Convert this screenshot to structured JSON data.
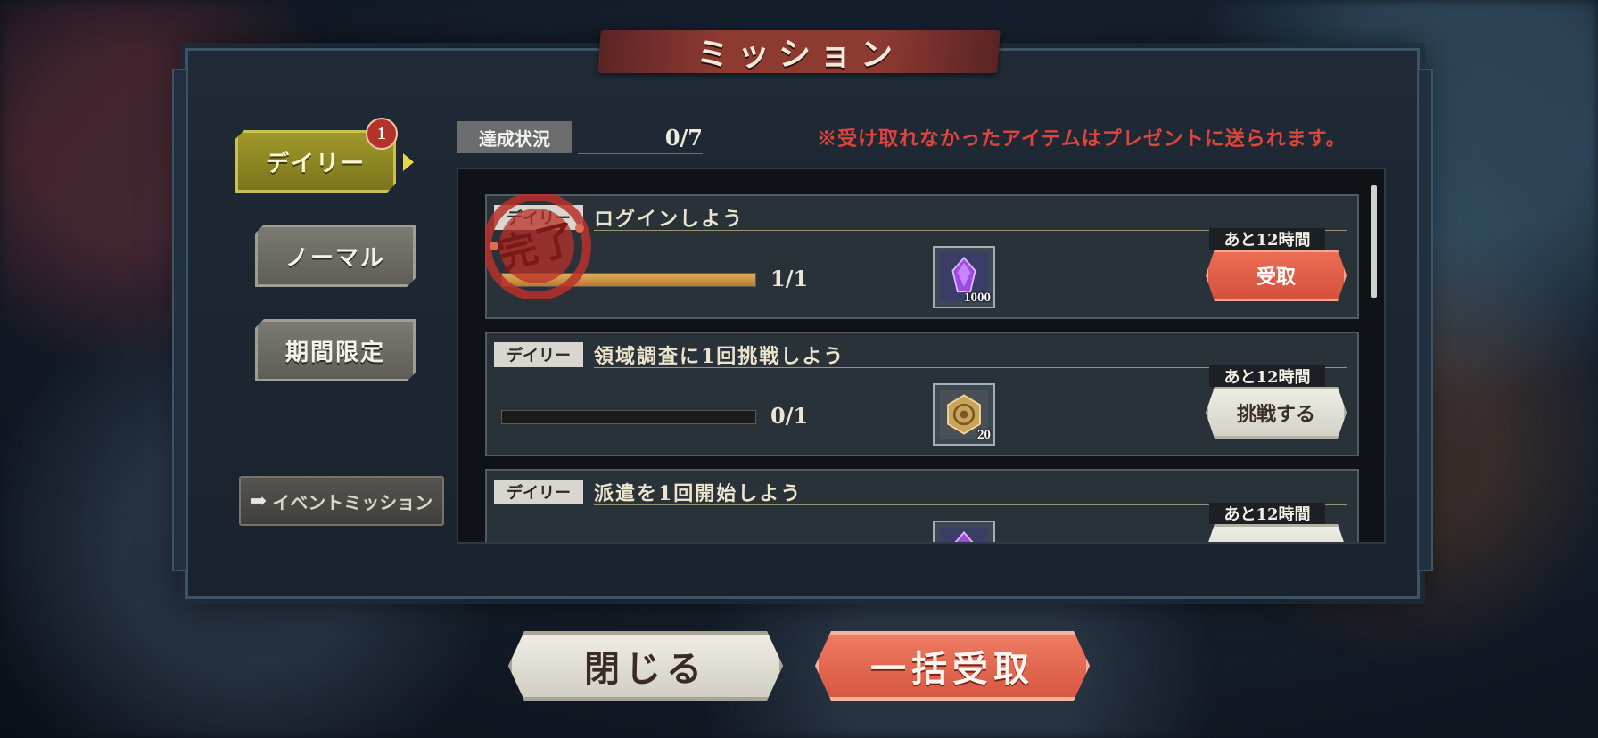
{
  "window": {
    "title": "ミッション"
  },
  "tabs": [
    {
      "label": "デイリー",
      "selected": true,
      "badge": "1"
    },
    {
      "label": "ノーマル",
      "selected": false
    },
    {
      "label": "期間限定",
      "selected": false
    }
  ],
  "event_button": {
    "label": "イベントミッション",
    "icon": "arrow-right-icon"
  },
  "status": {
    "label": "達成状況",
    "value": "0/7"
  },
  "notice": "※受け取れなかったアイテムはプレゼントに送られます。",
  "missions": [
    {
      "tag": "デイリー",
      "title": "ログインしよう",
      "progress": "1/1",
      "progress_fraction": 1.0,
      "reward_icon": "purple-crystal-icon",
      "reward_qty": "1000",
      "time_left": "あと12時間",
      "button": "受取",
      "button_style": "red",
      "completed_stamp": "完了"
    },
    {
      "tag": "デイリー",
      "title": "領域調査に1回挑戦しよう",
      "progress": "0/1",
      "progress_fraction": 0.0,
      "reward_icon": "gold-coin-icon",
      "reward_qty": "20",
      "time_left": "あと12時間",
      "button": "挑戦する",
      "button_style": "cream"
    },
    {
      "tag": "デイリー",
      "title": "派遣を1回開始しよう",
      "reward_icon": "purple-crystal-icon",
      "time_left": "あと12時間"
    }
  ],
  "footer": {
    "close_label": "閉じる",
    "collect_all_label": "一括受取"
  },
  "colors": {
    "accent_red": "#d2503d",
    "daily_tab": "#a29a2a",
    "notice": "#e0443d",
    "panel": "#1f2a36"
  }
}
